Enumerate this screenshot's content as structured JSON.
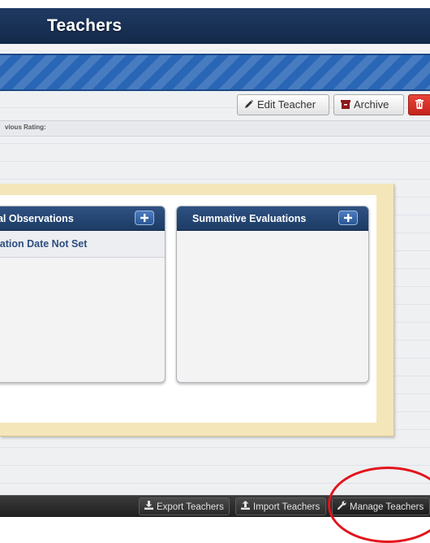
{
  "header": {
    "title": "Teachers"
  },
  "toolbar": {
    "edit_label": "Edit Teacher",
    "archive_label": "Archive",
    "delete_icon": "trash-icon"
  },
  "info": {
    "previous_rating_label": "vious Rating:"
  },
  "panels": {
    "observations": {
      "title": "rmal Observations",
      "items": [
        {
          "text": "ervation Date Not Set"
        }
      ]
    },
    "summative": {
      "title": "Summative Evaluations"
    }
  },
  "footer": {
    "export_label": "Export Teachers",
    "import_label": "Import Teachers",
    "manage_label": "Manage Teachers"
  },
  "colors": {
    "header_bg": "#1f3a63",
    "band": "#2a66b6",
    "delete_button": "#d9332a",
    "annotation_circle": "#e3141c"
  }
}
